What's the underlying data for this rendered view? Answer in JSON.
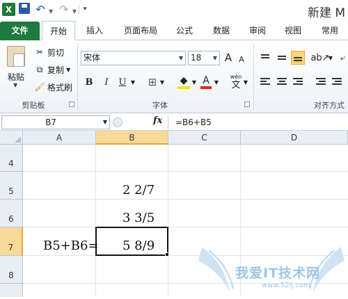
{
  "window": {
    "title": "新建 M"
  },
  "tabs": [
    "文件",
    "开始",
    "插入",
    "页面布局",
    "公式",
    "数据",
    "审阅",
    "视图",
    "常用"
  ],
  "clipboard": {
    "paste": "粘贴",
    "cut": "剪切",
    "copy": "复制",
    "format_painter": "格式刷",
    "group_label": "剪贴板"
  },
  "font_group": {
    "font_name": "宋体",
    "font_size": "18",
    "group_label": "字体",
    "bold": "B",
    "italic": "I",
    "underline": "U",
    "grow": "A",
    "shrink": "A",
    "phonetic_top": "wén",
    "phonetic_bottom": "文",
    "font_color": "A"
  },
  "alignment_group": {
    "group_label": "对齐方式"
  },
  "formula_bar": {
    "name_box": "B7",
    "fx": "fx",
    "formula": "=B6+B5"
  },
  "sheet": {
    "columns": [
      "A",
      "B",
      "C",
      "D"
    ],
    "rows": [
      "4",
      "5",
      "6",
      "7",
      "8"
    ],
    "cells": {
      "B5": "2  2/7",
      "B6": "3  3/5",
      "A7": "B5+B6=",
      "B7": "5  8/9"
    },
    "selected_cell": "B7"
  },
  "watermark": {
    "text": "我爱IT技术网",
    "url": "www.52ij.com"
  },
  "colors": {
    "file_tab": "#1f7a3f",
    "selection_header": "#f9d99a",
    "excel_green": "#1e7a3c"
  }
}
